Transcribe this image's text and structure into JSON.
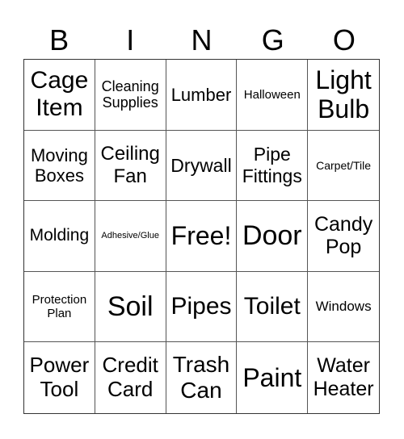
{
  "header": {
    "letters": [
      "B",
      "I",
      "N",
      "G",
      "O"
    ]
  },
  "grid": {
    "rows": [
      [
        "Cage Item",
        "Cleaning Supplies",
        "Lumber",
        "Halloween",
        "Light Bulb"
      ],
      [
        "Moving Boxes",
        "Ceiling Fan",
        "Drywall",
        "Pipe Fittings",
        "Carpet/Tile"
      ],
      [
        "Molding",
        "Adhesive/Glue",
        "Free!",
        "Door",
        "Candy Pop"
      ],
      [
        "Protection Plan",
        "Soil",
        "Pipes",
        "Toilet",
        "Windows"
      ],
      [
        "Power Tool",
        "Credit Card",
        "Trash Can",
        "Paint",
        "Water Heater"
      ]
    ]
  }
}
